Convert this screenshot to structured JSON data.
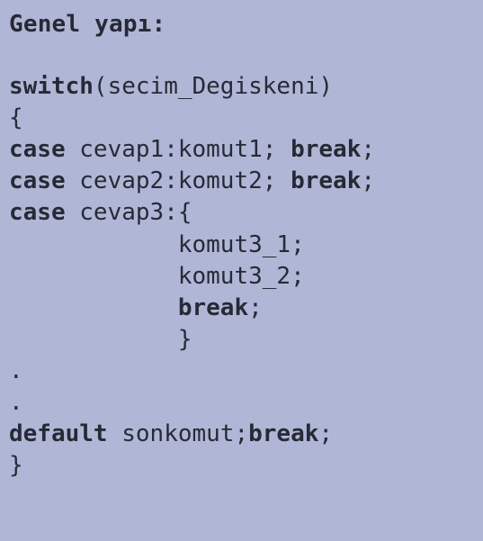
{
  "heading": "Genel yapı:",
  "code": {
    "kw_switch": "switch",
    "paren_open": "(",
    "var_name": "secim_Degiskeni",
    "paren_close": ")",
    "brace_open": "{",
    "kw_case1": "case",
    "case1_val": " cevap1:komut1; ",
    "kw_break1": "break",
    "semi1": ";",
    "kw_case2": "case",
    "case2_val": " cevap2:komut2; ",
    "kw_break2": "break",
    "semi2": ";",
    "kw_case3": "case",
    "case3_val": " cevap3:{",
    "indent": "            ",
    "c3_l1": "komut3_1;",
    "c3_l2": "komut3_2;",
    "kw_break3": "break",
    "semi3": ";",
    "c3_close": "}",
    "dot1": ".",
    "dot2": ".",
    "kw_default": "default",
    "def_body": " sonkomut;",
    "kw_break4": "break",
    "semi4": ";",
    "brace_close": "}"
  }
}
